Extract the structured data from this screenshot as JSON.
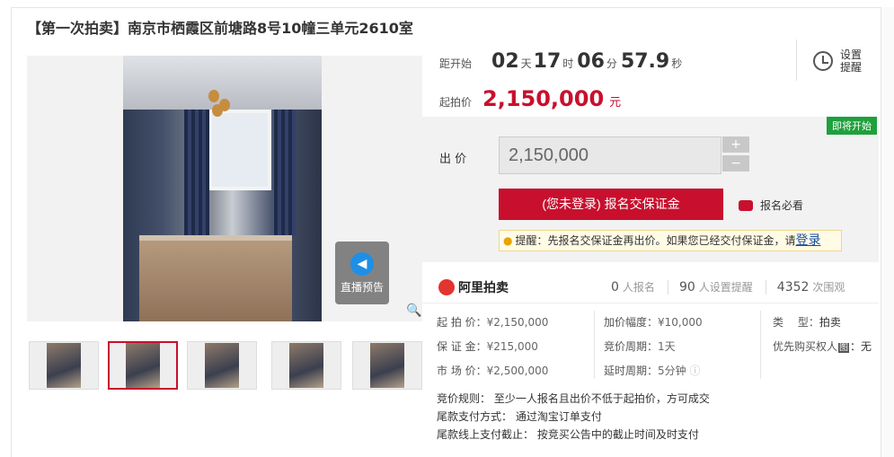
{
  "title": "【第一次拍卖】南京市栖霞区前塘路8号10幢三单元2610室",
  "gallery": {
    "live_label": "直播预告",
    "thumb_count": 5
  },
  "countdown": {
    "label": "距开始",
    "days": "02",
    "days_unit": "天",
    "hours": "17",
    "hours_unit": "时",
    "minutes": "06",
    "minutes_unit": "分",
    "seconds": "57.9",
    "seconds_unit": "秒"
  },
  "reminder": {
    "label": "设置提醒"
  },
  "start_price": {
    "label": "起拍价",
    "value": "2,150,000",
    "unit": "元"
  },
  "bid": {
    "badge": "即将开始",
    "label": "出 价",
    "input_value": "2,150,000",
    "plus": "+",
    "minus": "−",
    "signup_button": "(您未登录) 报名交保证金",
    "must_read": "报名必看",
    "tip": "提醒：先报名交保证金再出价。如果您已经交付保证金，请",
    "tip_link": "登录"
  },
  "stats": {
    "logo": "阿里拍卖",
    "signups": "0",
    "signups_label": "人报名",
    "reminders": "90",
    "reminders_label": "人设置提醒",
    "views": "4352",
    "views_label": "次围观"
  },
  "details": {
    "start_price_label": "起 拍 价：",
    "start_price": "¥2,150,000",
    "deposit_label": "保 证 金：",
    "deposit": "¥215,000",
    "market_price_label": "市 场 价：",
    "market_price": "¥2,500,000",
    "increment_label": "加价幅度：",
    "increment": "¥10,000",
    "cycle_label": "竞价周期：",
    "cycle": "1天",
    "delay_label": "延时周期：",
    "delay": "5分钟",
    "type_label": "类　 型：",
    "type": "拍卖",
    "priority_label": "优先购买权人",
    "priority_value": "：无"
  },
  "rules": {
    "rule": "竞价规则：  至少一人报名且出价不低于起拍价，方可成交",
    "payment": "尾款支付方式：  通过淘宝订单支付",
    "deadline": "尾款线上支付截止：  按竞买公告中的截止时间及时支付"
  },
  "colors": {
    "accent": "#c8102e",
    "badge": "#1ea03c",
    "link": "#1a4fa0"
  }
}
